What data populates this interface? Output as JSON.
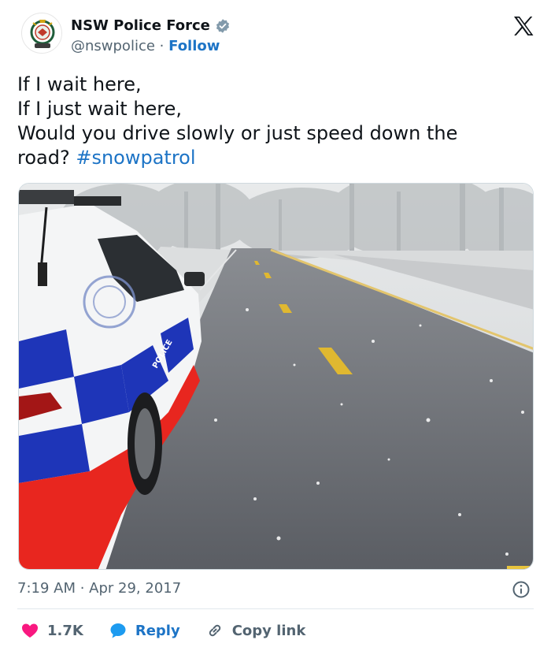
{
  "author": {
    "display_name": "NSW Police Force",
    "handle": "@nswpolice",
    "separator": "·",
    "follow_label": "Follow",
    "verified": true
  },
  "tweet": {
    "lines": [
      "If I wait here,",
      "If I just wait here,",
      "Would you drive slowly or just speed down the"
    ],
    "last_line_text": "road?",
    "hashtag": "#snowpatrol"
  },
  "media": {
    "car_door_text": "POLICE"
  },
  "meta": {
    "timestamp": "7:19 AM · Apr 29, 2017"
  },
  "actions": {
    "like_count": "1.7K",
    "reply_label": "Reply",
    "copy_link_label": "Copy link"
  },
  "colors": {
    "link": "#1d74c6",
    "like": "#f91880",
    "reply": "#1d9bf0",
    "muted": "#536471",
    "text": "#0f1419"
  },
  "icons": {
    "verified": "verified-badge-icon",
    "x_logo": "x-logo-icon",
    "info": "info-icon",
    "like": "heart-icon",
    "reply": "speech-bubble-icon",
    "copy": "link-icon"
  }
}
